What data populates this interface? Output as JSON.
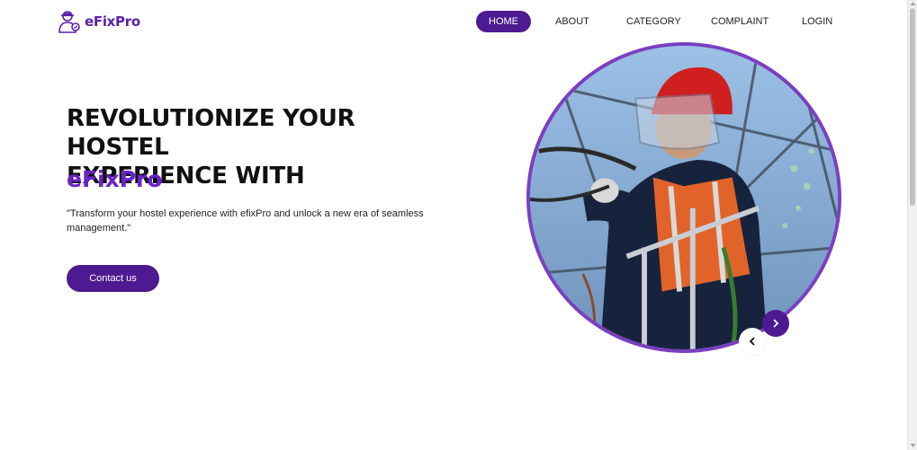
{
  "header": {
    "logo_text": "eFixPro",
    "logo_icon": "technician-icon",
    "nav": [
      {
        "label": "HOME",
        "active": true
      },
      {
        "label": "ABOUT",
        "active": false
      },
      {
        "label": "CATEGORY",
        "active": false
      },
      {
        "label": "COMPLAINT",
        "active": false
      },
      {
        "label": "LOGIN",
        "active": false
      }
    ]
  },
  "hero": {
    "headline_line1": "REVOLUTIONIZE YOUR HOSTEL",
    "headline_line2": "EXPERIENCE WITH",
    "brand": "eFixPro",
    "tagline": "\"Transform your hostel experience with efixPro and unlock a new era of seamless management.\"",
    "cta_label": "Contact us",
    "image_icon": "electrician-photo"
  },
  "carousel": {
    "next_icon": "chevron-right-icon",
    "prev_icon": "chevron-left-icon"
  },
  "colors": {
    "primary": "#4e1a91",
    "brand_text": "#6a24c8",
    "circle_border": "#7a3fc1"
  }
}
